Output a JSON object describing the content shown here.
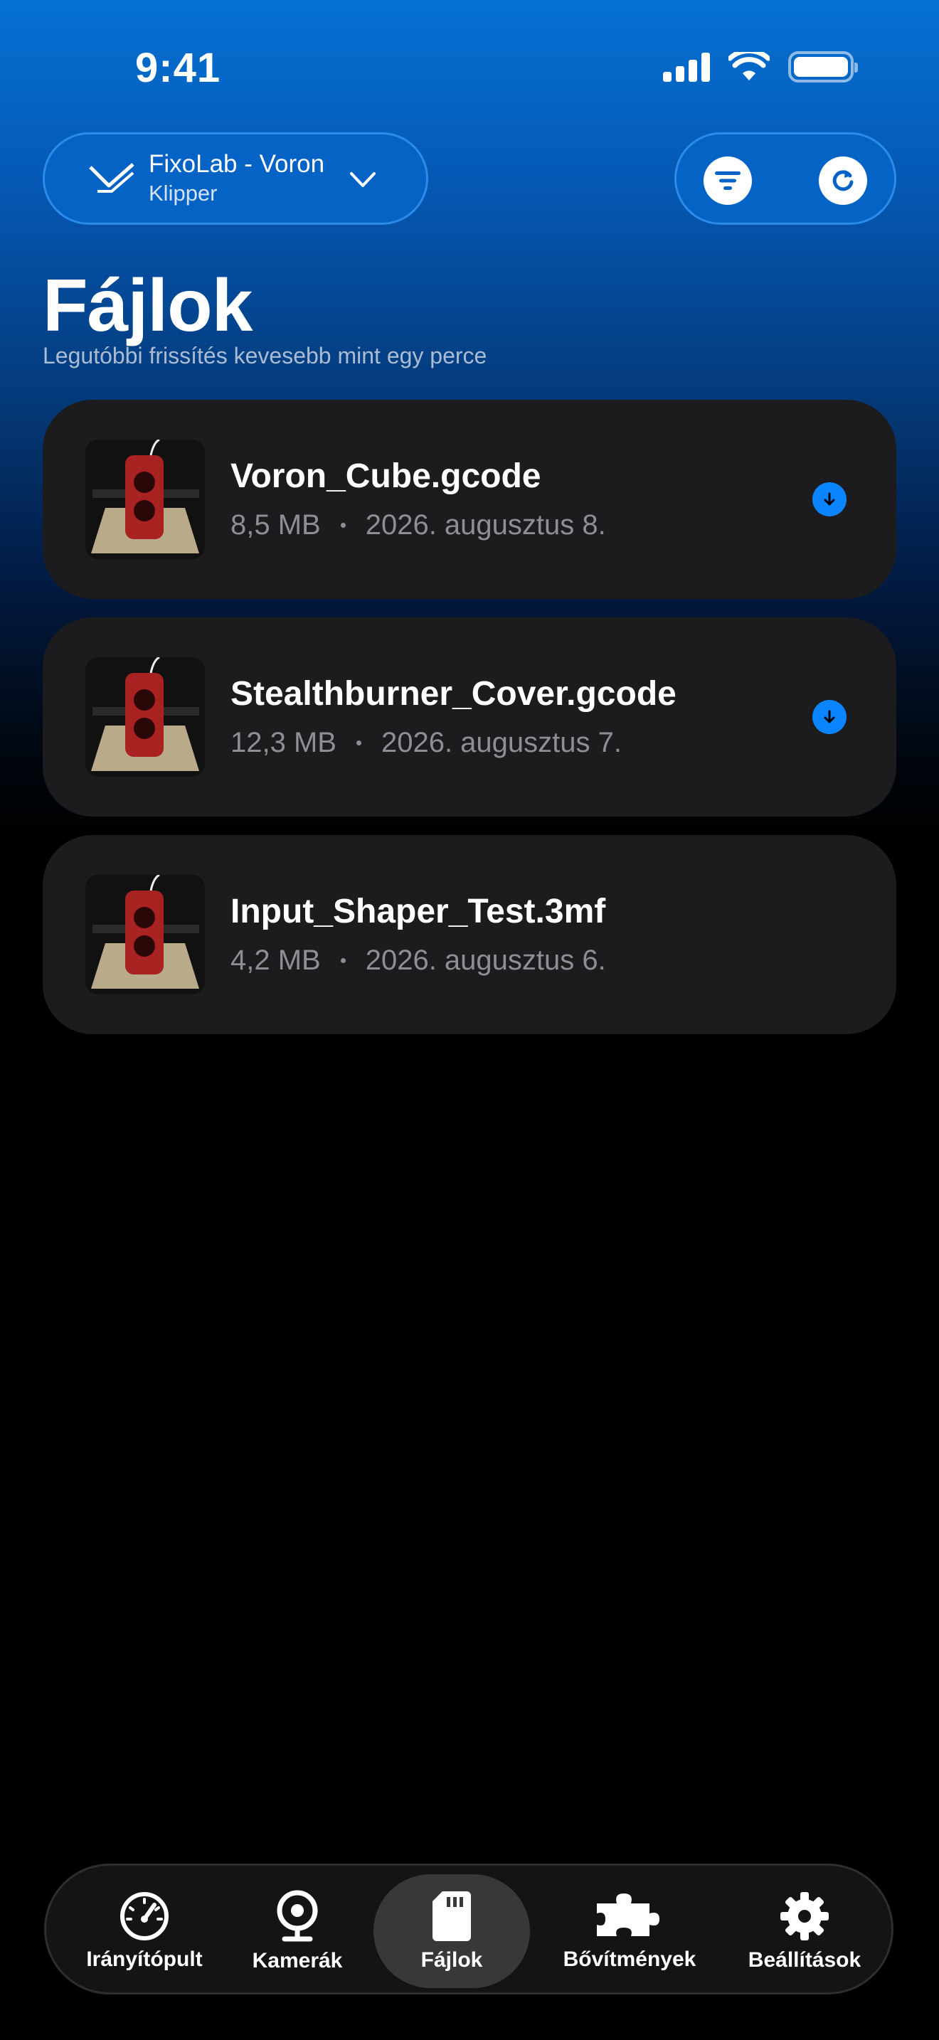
{
  "status_bar": {
    "time": "9:41"
  },
  "printer": {
    "name": "FixoLab - Voron",
    "firmware": "Klipper"
  },
  "header_actions": [
    "filter",
    "refresh"
  ],
  "page": {
    "title": "Fájlok",
    "subtitle": "Legutóbbi frissítés kevesebb mint egy perce"
  },
  "files": [
    {
      "name": "Voron_Cube.gcode",
      "size": "8,5 MB",
      "date": "2026. augusztus 8.",
      "downloadable": true
    },
    {
      "name": "Stealthburner_Cover.gcode",
      "size": "12,3 MB",
      "date": "2026. augusztus 7.",
      "downloadable": true
    },
    {
      "name": "Input_Shaper_Test.3mf",
      "size": "4,2 MB",
      "date": "2026. augusztus 6.",
      "downloadable": false
    }
  ],
  "tabs": [
    {
      "label": "Irányítópult",
      "icon": "gauge-icon",
      "active": false
    },
    {
      "label": "Kamerák",
      "icon": "webcam-icon",
      "active": false
    },
    {
      "label": "Fájlok",
      "icon": "sd-card-icon",
      "active": true
    },
    {
      "label": "Bővítmények",
      "icon": "puzzle-icon",
      "active": false
    },
    {
      "label": "Beállítások",
      "icon": "gear-icon",
      "active": false
    }
  ],
  "colors": {
    "accent": "#0a84ff",
    "card": "#1c1c1e",
    "header_blue": "#0563c6"
  }
}
